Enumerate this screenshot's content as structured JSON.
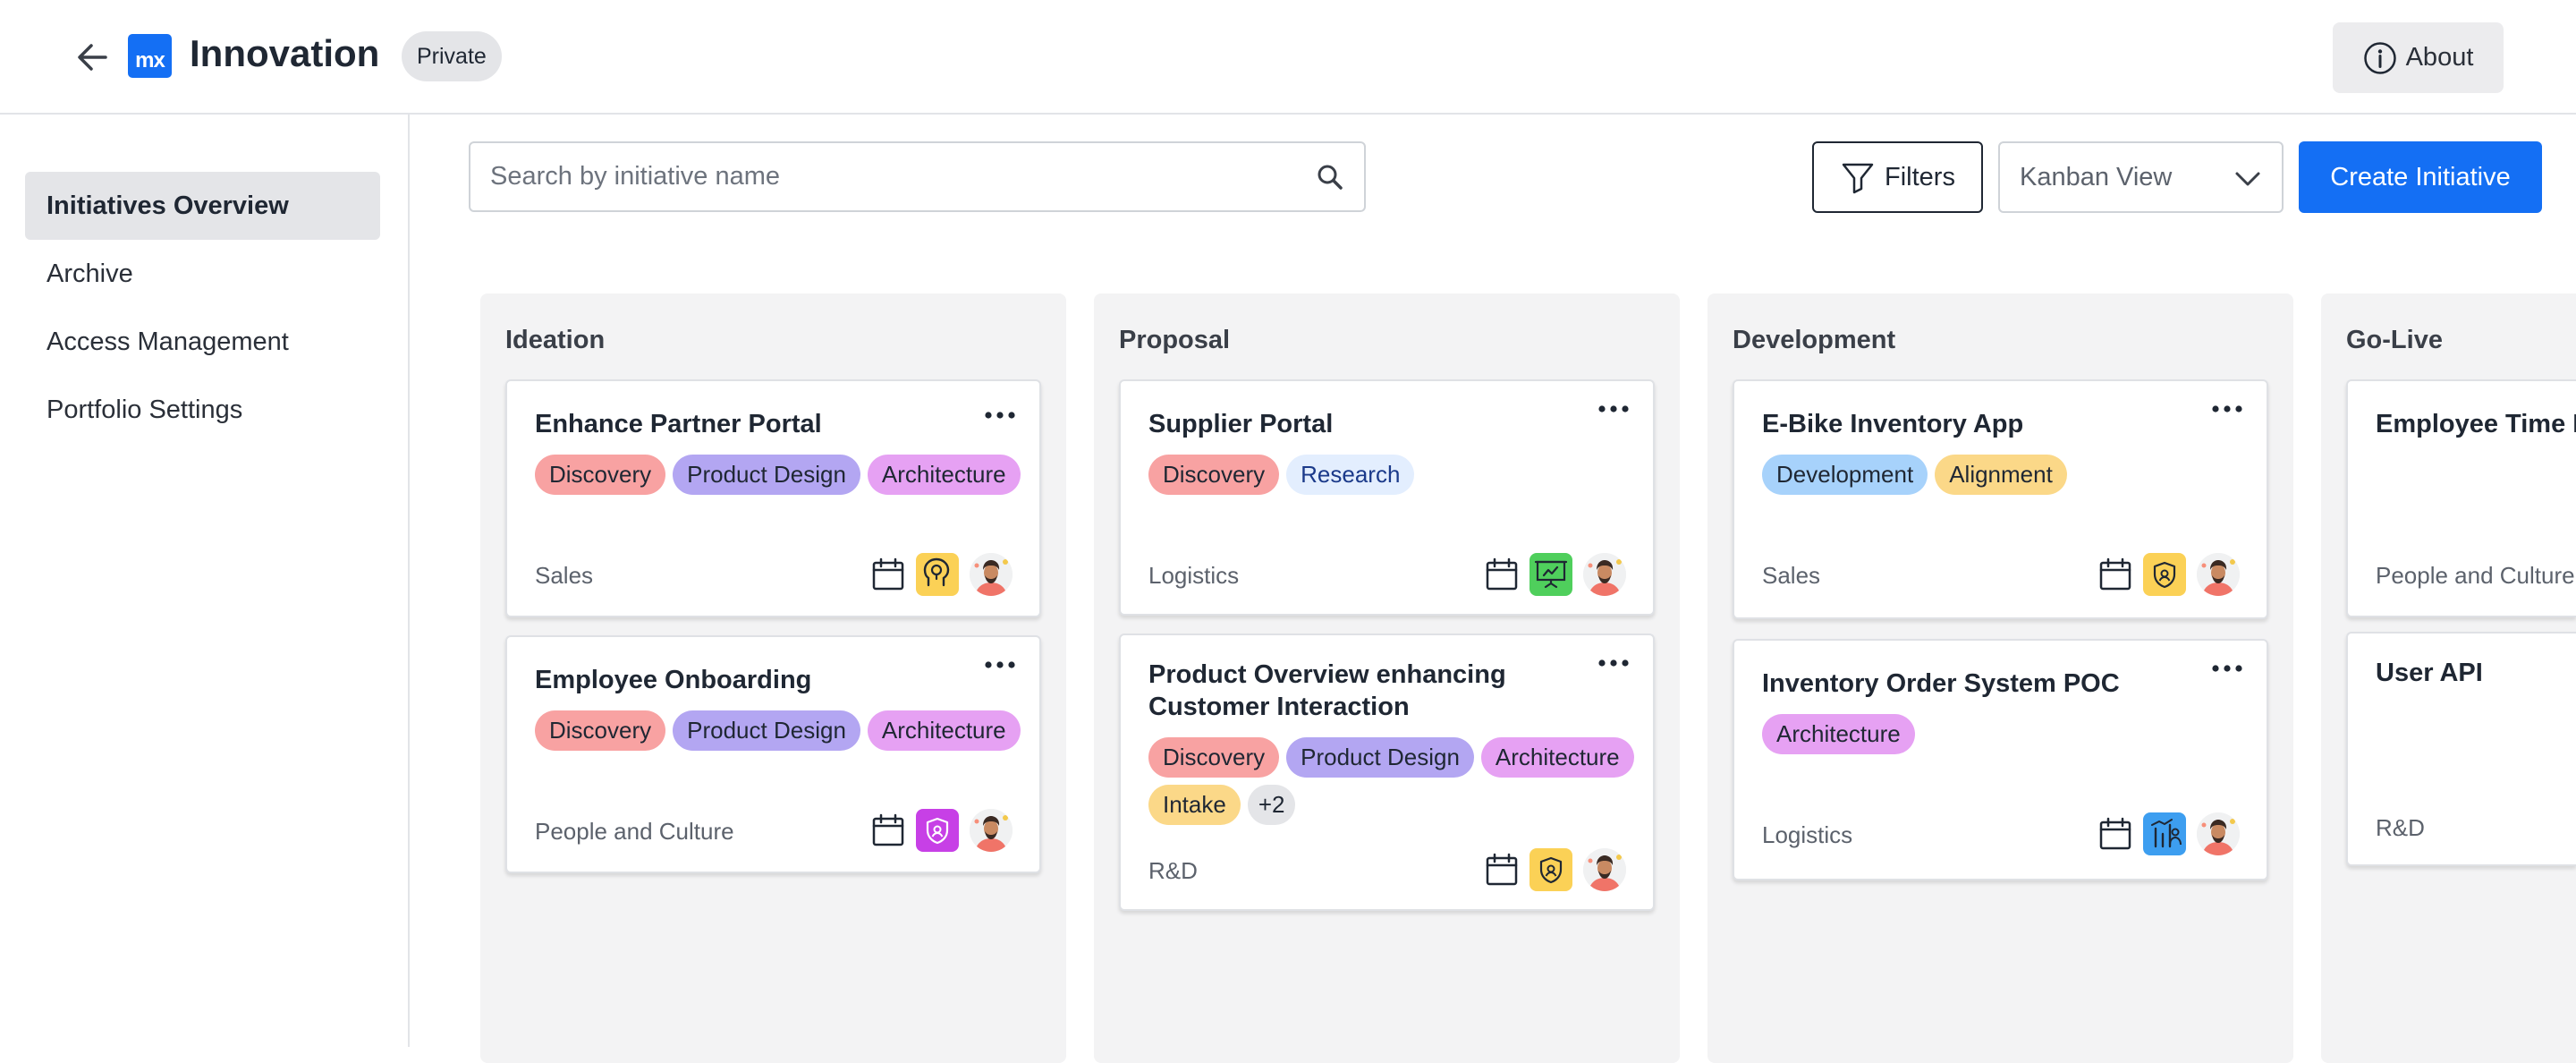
{
  "header": {
    "logo_text": "mx",
    "title": "Innovation",
    "privacy_badge": "Private",
    "about_label": "About"
  },
  "sidebar": {
    "items": [
      {
        "label": "Initiatives Overview",
        "active": true
      },
      {
        "label": "Archive",
        "active": false
      },
      {
        "label": "Access Management",
        "active": false
      },
      {
        "label": "Portfolio Settings",
        "active": false
      }
    ]
  },
  "toolbar": {
    "search_placeholder": "Search by initiative name",
    "filters_label": "Filters",
    "view_selected": "Kanban View",
    "create_label": "Create Initiative"
  },
  "colors": {
    "accent": "#146ff4",
    "tag_discovery": "#f8a2a2",
    "tag_product_design": "#b3a6f2",
    "tag_architecture": "#e6a1f3",
    "tag_research": "#e3eefe",
    "tag_development": "#a7d2fb",
    "tag_alignment": "#fbd888",
    "tag_intake": "#fbd888",
    "tag_more": "#e4e5e8"
  },
  "columns": [
    {
      "title": "Ideation",
      "cards": [
        {
          "title": "Enhance Partner Portal",
          "tags": [
            "Discovery",
            "Product Design",
            "Architecture"
          ],
          "department": "Sales",
          "badge_icon": "lightbulb-head-icon",
          "badge_color": "#fbd156"
        },
        {
          "title": "Employee Onboarding",
          "tags": [
            "Discovery",
            "Product Design",
            "Architecture"
          ],
          "department": "People and Culture",
          "badge_icon": "shield-icon",
          "badge_color": "#c740e6"
        }
      ]
    },
    {
      "title": "Proposal",
      "cards": [
        {
          "title": "Supplier Portal",
          "tags": [
            "Discovery",
            "Research"
          ],
          "department": "Logistics",
          "badge_icon": "presentation-icon",
          "badge_color": "#4fcf5c"
        },
        {
          "title": "Product Overview enhancing Customer Interaction",
          "tags": [
            "Discovery",
            "Product Design",
            "Architecture",
            "Intake",
            "+2"
          ],
          "department": "R&D",
          "badge_icon": "shield-icon",
          "badge_color": "#fbd156"
        }
      ]
    },
    {
      "title": "Development",
      "cards": [
        {
          "title": "E-Bike Inventory App",
          "tags": [
            "Development",
            "Alignment"
          ],
          "department": "Sales",
          "badge_icon": "shield-icon",
          "badge_color": "#fbd156"
        },
        {
          "title": "Inventory Order System POC",
          "tags": [
            "Architecture"
          ],
          "department": "Logistics",
          "badge_icon": "chart-person-icon",
          "badge_color": "#3d9ef0"
        }
      ]
    },
    {
      "title": "Go-Live",
      "cards": [
        {
          "title": "Employee Time R",
          "tags": [],
          "department": "People and Culture"
        },
        {
          "title": "User API",
          "tags": [],
          "department": "R&D"
        }
      ]
    }
  ]
}
